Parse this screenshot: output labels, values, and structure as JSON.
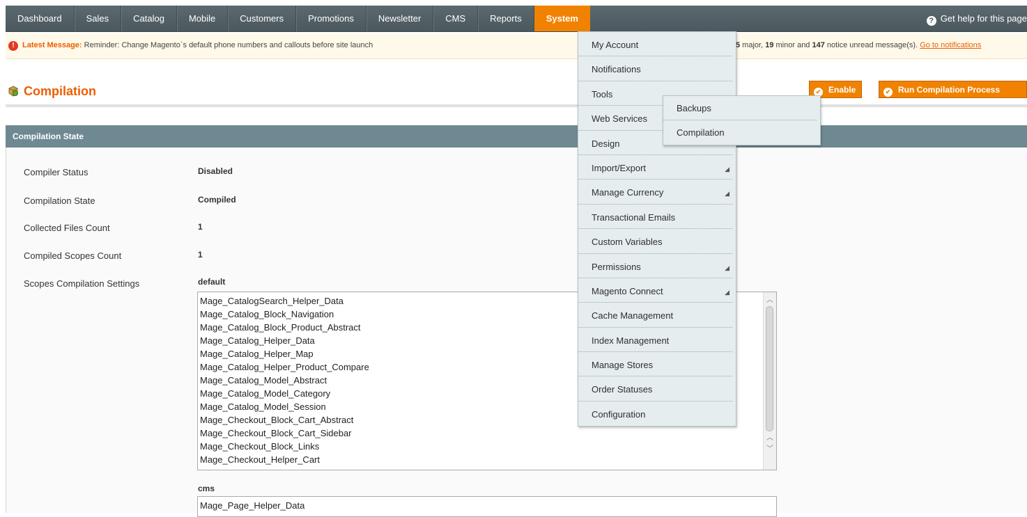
{
  "nav": {
    "items": [
      {
        "label": "Dashboard"
      },
      {
        "label": "Sales"
      },
      {
        "label": "Catalog"
      },
      {
        "label": "Mobile"
      },
      {
        "label": "Customers"
      },
      {
        "label": "Promotions"
      },
      {
        "label": "Newsletter"
      },
      {
        "label": "CMS"
      },
      {
        "label": "Reports"
      },
      {
        "label": "System"
      }
    ],
    "active": "System",
    "help_label": "Get help for this page",
    "help_icon": "question-circle-icon"
  },
  "message": {
    "latest_label": "Latest Message:",
    "text": "Reminder: Change Magento`s default phone numbers and callouts before site launch",
    "major_count": "5",
    "major_text": " major, ",
    "minor_count": "19",
    "minor_text": " minor and ",
    "notice_count": "147",
    "notice_text": " notice unread message(s). ",
    "link": "Go to notifications",
    "icon": "alert-icon",
    "icon_color": "#e03b24"
  },
  "page": {
    "title": "Compilation",
    "title_color": "#eb5e00",
    "buttons": {
      "enable": "Enable",
      "run": "Run Compilation Process"
    },
    "accent": "#f18200"
  },
  "section": {
    "title": "Compilation State",
    "fields": [
      {
        "label": "Compiler Status",
        "value": "Disabled"
      },
      {
        "label": "Compilation State",
        "value": "Compiled"
      },
      {
        "label": "Collected Files Count",
        "value": "1"
      },
      {
        "label": "Compiled Scopes Count",
        "value": "1"
      }
    ],
    "scopes_label": "Scopes Compilation Settings",
    "scopes": [
      {
        "name": "default",
        "lines": [
          "Mage_CatalogSearch_Helper_Data",
          "Mage_Catalog_Block_Navigation",
          "Mage_Catalog_Block_Product_Abstract",
          "Mage_Catalog_Helper_Data",
          "Mage_Catalog_Helper_Map",
          "Mage_Catalog_Helper_Product_Compare",
          "Mage_Catalog_Model_Abstract",
          "Mage_Catalog_Model_Category",
          "Mage_Catalog_Model_Session",
          "Mage_Checkout_Block_Cart_Abstract",
          "Mage_Checkout_Block_Cart_Sidebar",
          "Mage_Checkout_Block_Links",
          "Mage_Checkout_Helper_Cart"
        ]
      },
      {
        "name": "cms",
        "lines": [
          "Mage_Page_Helper_Data"
        ]
      }
    ]
  },
  "system_menu": {
    "items": [
      {
        "label": "My Account"
      },
      {
        "label": "Notifications"
      },
      {
        "label": "Tools"
      },
      {
        "label": "Web Services"
      },
      {
        "label": "Design"
      },
      {
        "label": "Import/Export",
        "arrow": true
      },
      {
        "label": "Manage Currency",
        "arrow": true
      },
      {
        "label": "Transactional Emails"
      },
      {
        "label": "Custom Variables"
      },
      {
        "label": "Permissions",
        "arrow": true
      },
      {
        "label": "Magento Connect",
        "arrow": true
      },
      {
        "label": "Cache Management"
      },
      {
        "label": "Index Management"
      },
      {
        "label": "Manage Stores"
      },
      {
        "label": "Order Statuses"
      },
      {
        "label": "Configuration"
      }
    ],
    "tools_submenu": [
      {
        "label": "Backups"
      },
      {
        "label": "Compilation"
      }
    ]
  }
}
